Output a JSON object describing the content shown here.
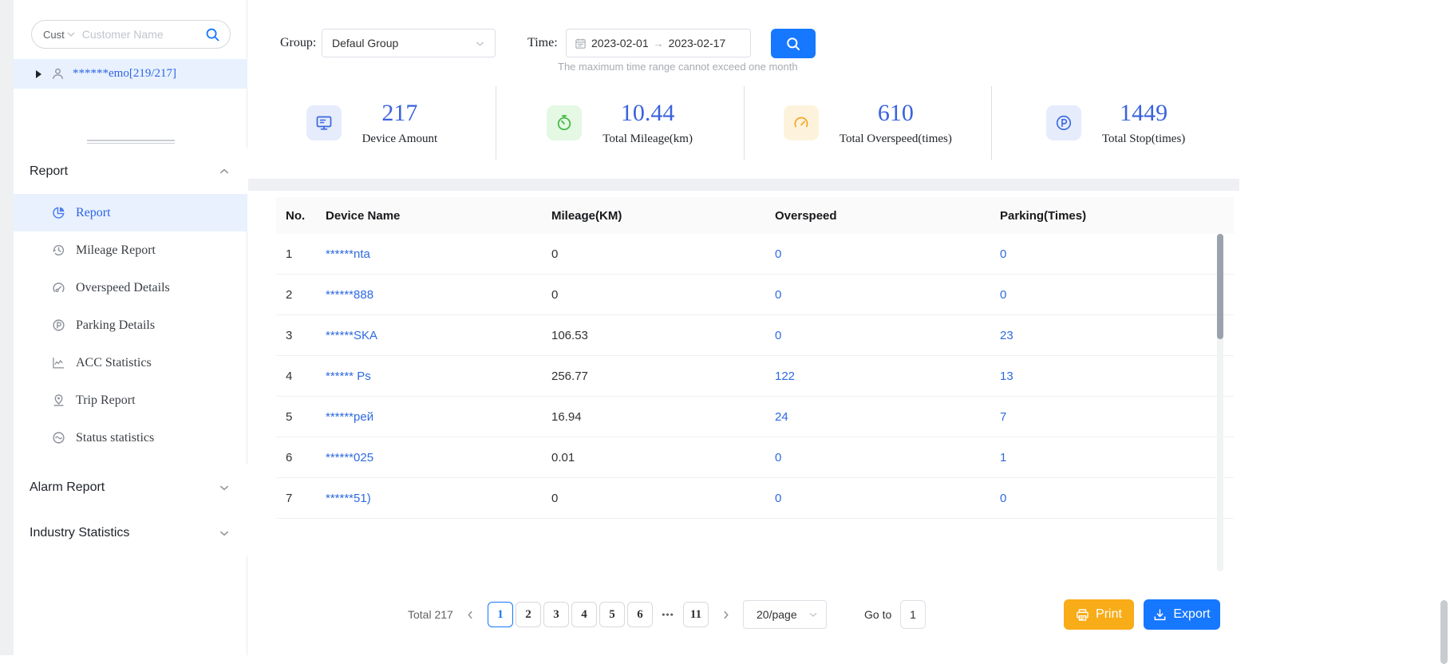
{
  "colors": {
    "accent": "#1677ff",
    "link": "#2e6ae0",
    "print": "#f8ac18",
    "stat_number": "#3a63dd",
    "highlight": "#e8f1fd",
    "green": "#41b841",
    "amber": "#f5a623"
  },
  "sidebar": {
    "search": {
      "select_label": "Cust",
      "select_icon": "chevron-down-icon",
      "placeholder": "Customer Name",
      "icon": "search-icon"
    },
    "tree_item": {
      "label": "******emo[219/217]",
      "icons": [
        "caret-right-icon",
        "user-icon"
      ]
    },
    "sections": [
      {
        "label": "Report",
        "state_icon": "chevron-up-icon",
        "items": [
          {
            "label": "Report",
            "icon": "pie-chart-icon",
            "active": true
          },
          {
            "label": "Mileage Report",
            "icon": "history-clock-icon",
            "active": false
          },
          {
            "label": "Overspeed Details",
            "icon": "speedometer-icon",
            "active": false
          },
          {
            "label": "Parking Details",
            "icon": "parking-circle-icon",
            "active": false
          },
          {
            "label": "ACC Statistics",
            "icon": "line-chart-icon",
            "active": false
          },
          {
            "label": "Trip Report",
            "icon": "location-pin-icon",
            "active": false
          },
          {
            "label": "Status statistics",
            "icon": "status-wave-icon",
            "active": false
          }
        ]
      },
      {
        "label": "Alarm Report",
        "state_icon": "chevron-down-icon",
        "items": []
      },
      {
        "label": "Industry Statistics",
        "state_icon": "chevron-down-icon",
        "items": []
      }
    ]
  },
  "toolbar": {
    "group_label": "Group:",
    "group_value": "Defaul Group",
    "time_label": "Time:",
    "date_start": "2023-02-01",
    "date_separator": "→",
    "date_end": "2023-02-17",
    "search_icon": "search-icon",
    "hint": "The maximum time range cannot exceed one month"
  },
  "stats": {
    "items": [
      {
        "value": "217",
        "label": "Device Amount",
        "icon": "monitor-icon",
        "tone": "blue"
      },
      {
        "value": "10.44",
        "label": "Total Mileage(km)",
        "icon": "stopwatch-icon",
        "tone": "green"
      },
      {
        "value": "610",
        "label": "Total Overspeed(times)",
        "icon": "gauge-icon",
        "tone": "amber"
      },
      {
        "value": "1449",
        "label": "Total Stop(times)",
        "icon": "parking-circle-icon",
        "tone": "blue"
      }
    ]
  },
  "table": {
    "headers": [
      "No.",
      "Device Name",
      "Mileage(KM)",
      "Overspeed",
      "Parking(Times)"
    ],
    "rows": [
      {
        "no": "1",
        "name": "******nta",
        "mileage": "0",
        "overspeed": "0",
        "parking": "0"
      },
      {
        "no": "2",
        "name": "******888",
        "mileage": "0",
        "overspeed": "0",
        "parking": "0"
      },
      {
        "no": "3",
        "name": "******SKA",
        "mileage": "106.53",
        "overspeed": "0",
        "parking": "23"
      },
      {
        "no": "4",
        "name": "****** Ps",
        "mileage": "256.77",
        "overspeed": "122",
        "parking": "13"
      },
      {
        "no": "5",
        "name": "******рей",
        "mileage": "16.94",
        "overspeed": "24",
        "parking": "7"
      },
      {
        "no": "6",
        "name": "******025",
        "mileage": "0.01",
        "overspeed": "0",
        "parking": "1"
      },
      {
        "no": "7",
        "name": "******51)",
        "mileage": "0",
        "overspeed": "0",
        "parking": "0"
      }
    ]
  },
  "pagination": {
    "total_label": "Total 217",
    "pages": [
      "1",
      "2",
      "3",
      "4",
      "5",
      "6",
      "•••",
      "11"
    ],
    "active_page": "1",
    "page_size": "20/page",
    "goto_label": "Go to",
    "goto_value": "1"
  },
  "actions": {
    "print_label": "Print",
    "export_label": "Export"
  }
}
